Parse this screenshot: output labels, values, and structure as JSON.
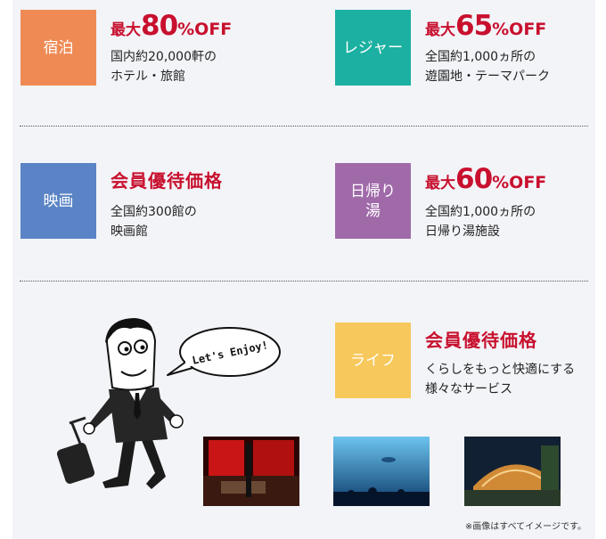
{
  "categories": [
    {
      "id": "lodging",
      "label": "宿泊",
      "headline_pre": "最大",
      "headline_big": "80",
      "headline_post": "%OFF",
      "desc1": "国内約20,000軒の",
      "desc2": "ホテル・旅館",
      "color": "#ef8a55"
    },
    {
      "id": "leisure",
      "label": "レジャー",
      "headline_pre": "最大",
      "headline_big": "65",
      "headline_post": "%OFF",
      "desc1": "全国約1,000ヵ所の",
      "desc2": "遊園地・テーマパーク",
      "color": "#1bb0a1"
    },
    {
      "id": "movie",
      "label": "映画",
      "headline": "会員優待価格",
      "desc1": "全国約300館の",
      "desc2": "映画館",
      "color": "#5a84c5"
    },
    {
      "id": "onsen",
      "label1": "日帰り",
      "label2": "湯",
      "headline_pre": "最大",
      "headline_big": "60",
      "headline_post": "%OFF",
      "desc1": "全国約1,000ヵ所の",
      "desc2": "日帰り湯施設",
      "color": "#a06aa9"
    },
    {
      "id": "life",
      "label": "ライフ",
      "headline": "会員優待価格",
      "desc1": "くらしをもっと快適にする",
      "desc2": "様々なサービス",
      "color": "#f7c85b"
    }
  ],
  "speech_bubble": "Let's Enjoy!",
  "footnote": "※画像はすべてイメージです。",
  "accent_color": "#c8102e"
}
